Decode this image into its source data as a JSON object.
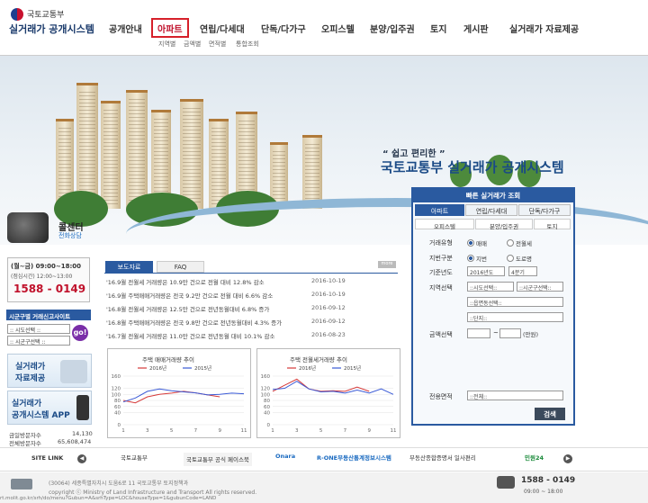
{
  "header": {
    "ministry": "국토교통부",
    "system_name": "실거래가 공개시스템",
    "nav": [
      "공개안내",
      "아파트",
      "연립/다세대",
      "단독/다가구",
      "오피스텔",
      "분양/입주권",
      "토지",
      "게시판",
      "실거래가 자료제공"
    ],
    "active_nav": "아파트",
    "sub_nav": [
      "지역별",
      "금액별",
      "면적별",
      "통합조회"
    ]
  },
  "hero": {
    "quote": "“ 쉽고 편리한 ”",
    "title": "국토교통부 실거래가 공개시스템"
  },
  "callcenter": {
    "title": "콜센터",
    "subtitle": "전화상담",
    "hours": "(월~금) 09:00~18:00",
    "lunch": "(점심시간) 12:00~13:00",
    "phone": "1588 - 0149"
  },
  "area_search": {
    "title": "시군구별 거래신고사이트",
    "sido_placeholder": ":: 시도선택 ::",
    "sigungu_placeholder": ":: 시군구선택 ::",
    "go_label": "go!"
  },
  "side_banners": {
    "data_label_1": "실거래가",
    "data_label_2": "자료제공",
    "app_label_1": "실거래가",
    "app_label_2": "공개시스템 APP"
  },
  "stats": {
    "today_label": "금일방문자수",
    "today_value": "14,130",
    "total_label": "전체방문자수",
    "total_value": "65,608,474"
  },
  "news": {
    "tabs": [
      "보도자료",
      "FAQ"
    ],
    "more": "more",
    "items": [
      {
        "title": "'16.9월 전월세 거래량은 10.9만 건으로 전월 대비 12.8% 감소",
        "date": "2016-10-19"
      },
      {
        "title": "'16.9월 주택매매거래량은 전국 9.2만 건으로 전월 대비 6.6% 감소",
        "date": "2016-10-19"
      },
      {
        "title": "'16.8월 전월세 거래량은 12.5만 건으로 전년동월대비 6.8% 증가",
        "date": "2016-09-12"
      },
      {
        "title": "'16.8월 주택매매거래량은 전국 9.8만 건으로 전년동월대비 4.3% 증가",
        "date": "2016-09-12"
      },
      {
        "title": "'16.7월 전월세 거래량은 11.0만 건으로 전년동월 대비 10.1% 감소",
        "date": "2016-08-23"
      }
    ]
  },
  "mini_charts": [
    {
      "title": "주택 매매거래량 추이",
      "legend": [
        "2016년",
        "2015년"
      ]
    },
    {
      "title": "주택 전월세거래량 추이",
      "legend": [
        "2016년",
        "2015년"
      ]
    }
  ],
  "chart_data": [
    {
      "type": "line",
      "title": "주택 매매거래량 추이",
      "x": [
        1,
        3,
        5,
        7,
        9,
        11
      ],
      "ylim": [
        0,
        160
      ],
      "yticks": [
        0,
        40,
        60,
        80,
        100,
        120,
        160
      ],
      "series": [
        {
          "name": "2016년",
          "color": "#d63a3a",
          "points": [
            [
              1,
              80
            ],
            [
              2,
              72
            ],
            [
              3,
              92
            ],
            [
              4,
              100
            ],
            [
              5,
              104
            ],
            [
              6,
              110
            ],
            [
              7,
              105
            ],
            [
              8,
              98
            ],
            [
              9,
              92
            ]
          ]
        },
        {
          "name": "2015년",
          "color": "#3a5ad6",
          "points": [
            [
              1,
              75
            ],
            [
              2,
              88
            ],
            [
              3,
              110
            ],
            [
              4,
              118
            ],
            [
              5,
              112
            ],
            [
              6,
              108
            ],
            [
              7,
              105
            ],
            [
              8,
              98
            ],
            [
              9,
              100
            ],
            [
              10,
              104
            ],
            [
              11,
              102
            ]
          ]
        }
      ]
    },
    {
      "type": "line",
      "title": "주택 전월세거래량 추이",
      "x": [
        1,
        3,
        5,
        7,
        9,
        11
      ],
      "ylim": [
        0,
        160
      ],
      "yticks": [
        0,
        40,
        60,
        80,
        100,
        120,
        160
      ],
      "series": [
        {
          "name": "2016년",
          "color": "#d63a3a",
          "points": [
            [
              1,
              110
            ],
            [
              2,
              130
            ],
            [
              3,
              150
            ],
            [
              4,
              118
            ],
            [
              5,
              110
            ],
            [
              6,
              112
            ],
            [
              7,
              110
            ],
            [
              8,
              124
            ],
            [
              9,
              110
            ]
          ]
        },
        {
          "name": "2015년",
          "color": "#3a5ad6",
          "points": [
            [
              1,
              116
            ],
            [
              2,
              120
            ],
            [
              3,
              143
            ],
            [
              4,
              118
            ],
            [
              5,
              108
            ],
            [
              6,
              110
            ],
            [
              7,
              104
            ],
            [
              8,
              114
            ],
            [
              9,
              104
            ],
            [
              10,
              118
            ],
            [
              11,
              100
            ]
          ]
        }
      ]
    }
  ],
  "search_panel": {
    "title": "빠른 실거래가 조회",
    "tabs": [
      "아파트",
      "연립/다세대",
      "단독/다가구"
    ],
    "sub_tabs": [
      "오피스텔",
      "분양/입주권",
      "토지"
    ],
    "labels": {
      "deal_type": "거래유형",
      "addr_type": "지번구분",
      "year": "기준년도",
      "region": "지역선택",
      "price": "금액선택",
      "area": "전용면적"
    },
    "deal_options": [
      "매매",
      "전월세"
    ],
    "addr_options": [
      "지번",
      "도로명"
    ],
    "year_value": "2016년도",
    "quarter_value": "4분기",
    "sido_value": "::시도선택::",
    "sigungu_value": "::시군구선택::",
    "dong_value": "::읍면동선택::",
    "danji_value": "::단지::",
    "price_unit": "(만원)",
    "price_sep": "~",
    "area_value": "::전체::",
    "search_label": "검색"
  },
  "site_link": {
    "label": "SITE LINK",
    "logos": [
      "국토교통부",
      "국토교통부 공식 페이스북",
      "Onara",
      "R-ONE부동산통계정보시스템",
      "부동산종합증명서 일사편리",
      "민원24"
    ]
  },
  "footer": {
    "address": "(30064) 세종특별자치시 도움6로 11 국토교통부 토지정책과",
    "copyright": "copyright ⓒ Ministry of Land Infrastructure and Transport All rights reserved.",
    "url": "rt.molit.go.kr/srh/do/menu?Gubun=A&srhType=LOC&houseType=1&gubunCode=LAND",
    "phone": "1588 - 0149",
    "hours": "09:00 ~ 18:00"
  }
}
